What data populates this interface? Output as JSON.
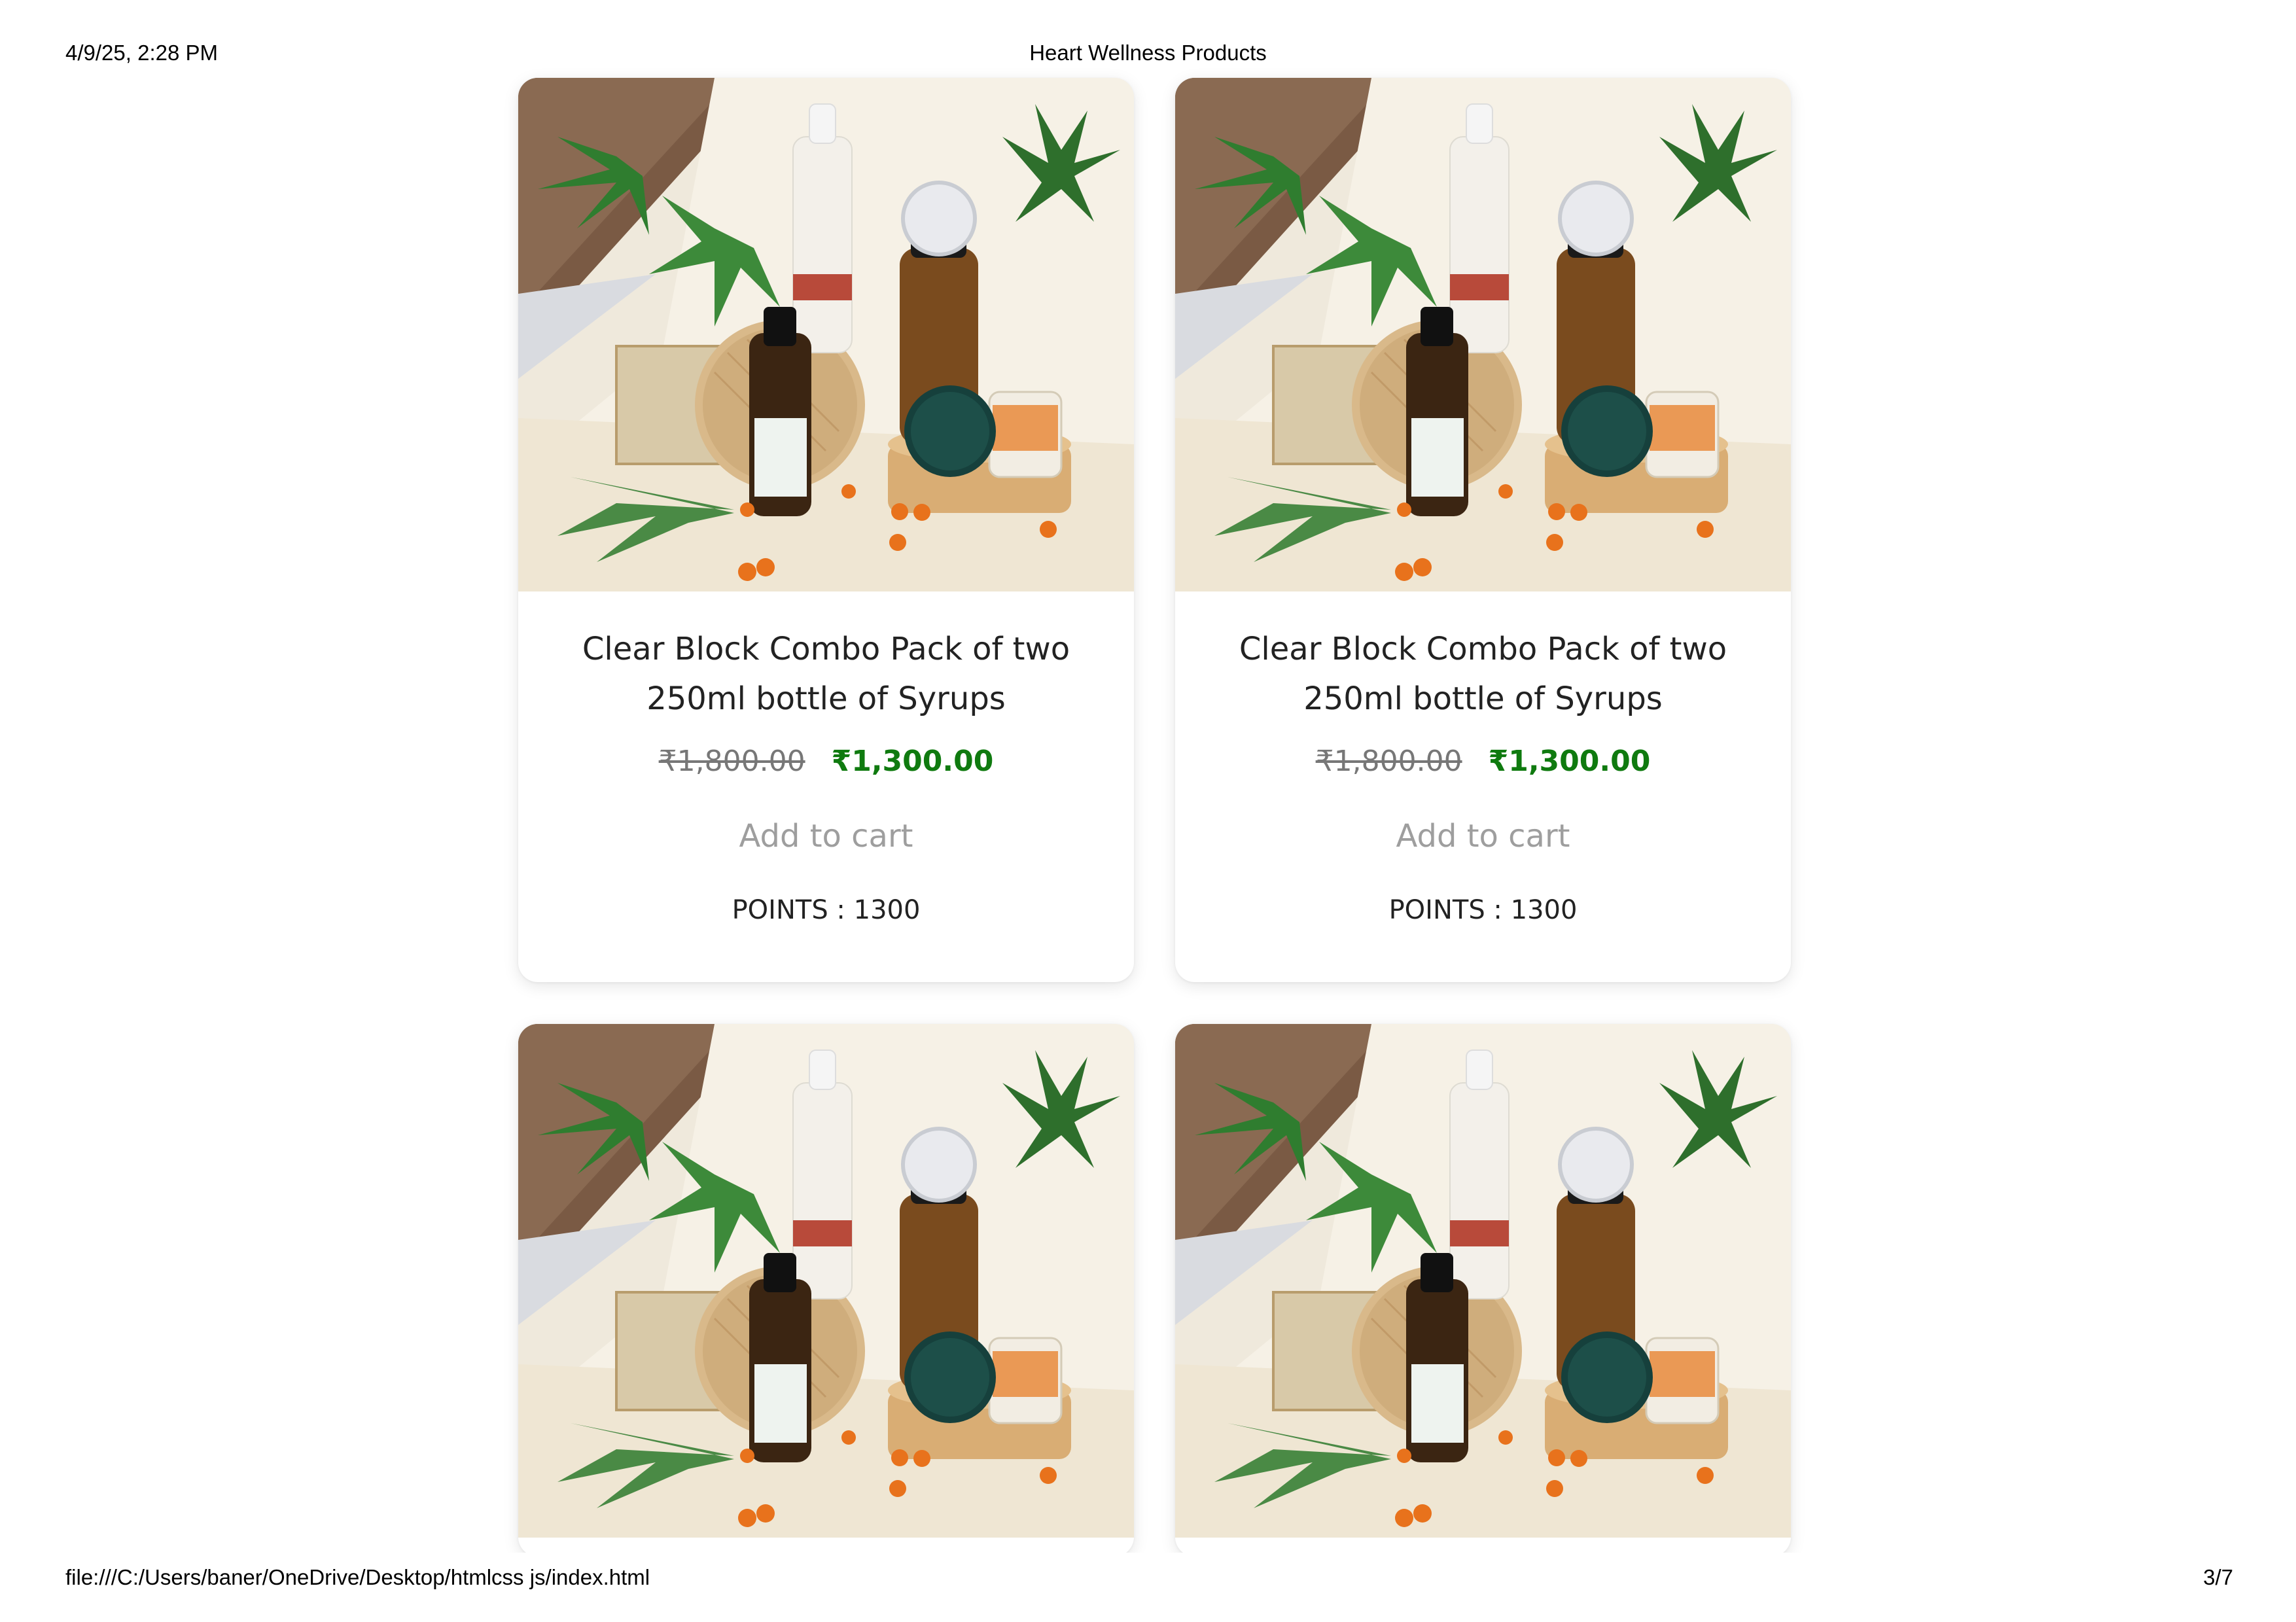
{
  "print_header": {
    "datetime": "4/9/25, 2:28 PM",
    "title": "Heart Wellness Products"
  },
  "print_footer": {
    "file_path": "file:///C:/Users/baner/OneDrive/Desktop/htmlcss js/index.html",
    "page_indicator": "3/7"
  },
  "products": [
    {
      "title": "Clear Block Combo Pack of two 250ml bottle of Syrups",
      "old_price": "₹1,800.00",
      "new_price": "₹1,300.00",
      "cart_label": "Add to cart",
      "points": "POINTS : 1300"
    },
    {
      "title": "Clear Block Combo Pack of two 250ml bottle of Syrups",
      "old_price": "₹1,800.00",
      "new_price": "₹1,300.00",
      "cart_label": "Add to cart",
      "points": "POINTS : 1300"
    }
  ],
  "colors": {
    "sale_price": "#0f7a0f",
    "old_price": "#777777",
    "cart_text": "#9e9e9e"
  }
}
